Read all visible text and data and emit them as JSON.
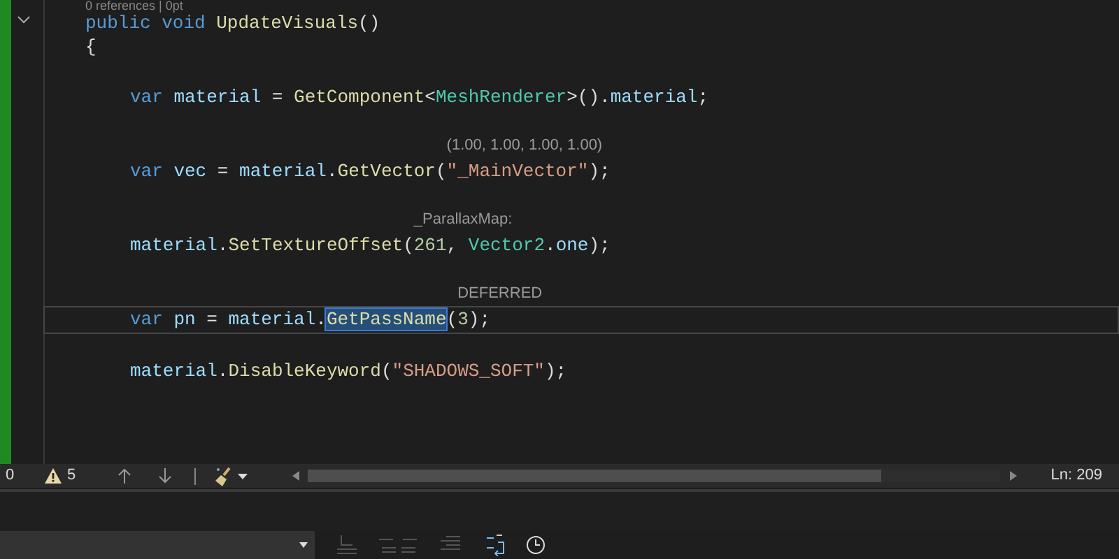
{
  "editor": {
    "codelens": "0 references | 0pt",
    "lines": [
      {
        "tokens": [
          {
            "kind": "keyword",
            "text": "public"
          },
          {
            "kind": "keyword",
            "text": " void"
          },
          {
            "kind": "method",
            "text": " UpdateVisuals"
          },
          {
            "kind": "plain",
            "text": "()"
          }
        ],
        "expanded": true
      },
      {
        "tokens": [
          {
            "kind": "plain",
            "text": "{"
          }
        ],
        "children": [
          {
            "tokens": [
              {
                "kind": "keyword",
                "text": "var"
              },
              {
                "kind": "variable",
                "text": " material"
              },
              {
                "kind": "plain",
                "text": " = "
              },
              {
                "kind": "method",
                "text": "GetComponent"
              },
              {
                "kind": "plain",
                "text": "<"
              },
              {
                "kind": "type",
                "text": "MeshRenderer"
              },
              {
                "kind": "plain",
                "text": ">()."
              },
              {
                "kind": "variable",
                "text": "material"
              },
              {
                "kind": "plain",
                "text": ";"
              }
            ],
            "current": false
          },
          {
            "tokens": [
              {
                "kind": "keyword",
                "text": "var"
              },
              {
                "kind": "variable",
                "text": " vec"
              },
              {
                "kind": "plain",
                "text": " = "
              },
              {
                "kind": "variable",
                "text": "material"
              },
              {
                "kind": "plain",
                "text": "."
              },
              {
                "kind": "method",
                "text": "GetVector"
              },
              {
                "kind": "plain",
                "text": "("
              },
              {
                "kind": "string",
                "text": "\"_MainVector\"",
                "hint": "(1.00, 1.00, 1.00, 1.00)"
              },
              {
                "kind": "plain",
                "text": ");"
              }
            ],
            "current": false
          },
          {
            "tokens": [
              {
                "kind": "variable",
                "text": "material"
              },
              {
                "kind": "plain",
                "text": "."
              },
              {
                "kind": "method",
                "text": "SetTextureOffset"
              },
              {
                "kind": "plain",
                "text": "("
              },
              {
                "kind": "number",
                "text": "261",
                "hint": "_ParallaxMap:"
              },
              {
                "kind": "plain",
                "text": ", "
              },
              {
                "kind": "type",
                "text": "Vector2"
              },
              {
                "kind": "plain",
                "text": "."
              },
              {
                "kind": "variable",
                "text": "one"
              },
              {
                "kind": "plain",
                "text": ");"
              }
            ],
            "current": false
          },
          {
            "tokens": [
              {
                "kind": "keyword",
                "text": "var"
              },
              {
                "kind": "variable",
                "text": " pn"
              },
              {
                "kind": "plain",
                "text": " = "
              },
              {
                "kind": "variable",
                "text": "material"
              },
              {
                "kind": "plain",
                "text": "."
              },
              {
                "kind": "method",
                "text": "GetPassName",
                "selected": true
              },
              {
                "kind": "plain",
                "text": "("
              },
              {
                "kind": "number",
                "text": "3",
                "hint": "DEFERRED"
              },
              {
                "kind": "plain",
                "text": ");"
              }
            ],
            "current": true
          },
          {
            "tokens": [
              {
                "kind": "variable",
                "text": "material"
              },
              {
                "kind": "plain",
                "text": "."
              },
              {
                "kind": "method",
                "text": "DisableKeyword"
              },
              {
                "kind": "plain",
                "text": "("
              },
              {
                "kind": "string",
                "text": "\"SHADOWS_SOFT\""
              },
              {
                "kind": "plain",
                "text": ");"
              }
            ],
            "current": false
          }
        ]
      }
    ]
  },
  "status_bar": {
    "errors": "0",
    "warnings": "5",
    "line": "Ln: 209"
  }
}
